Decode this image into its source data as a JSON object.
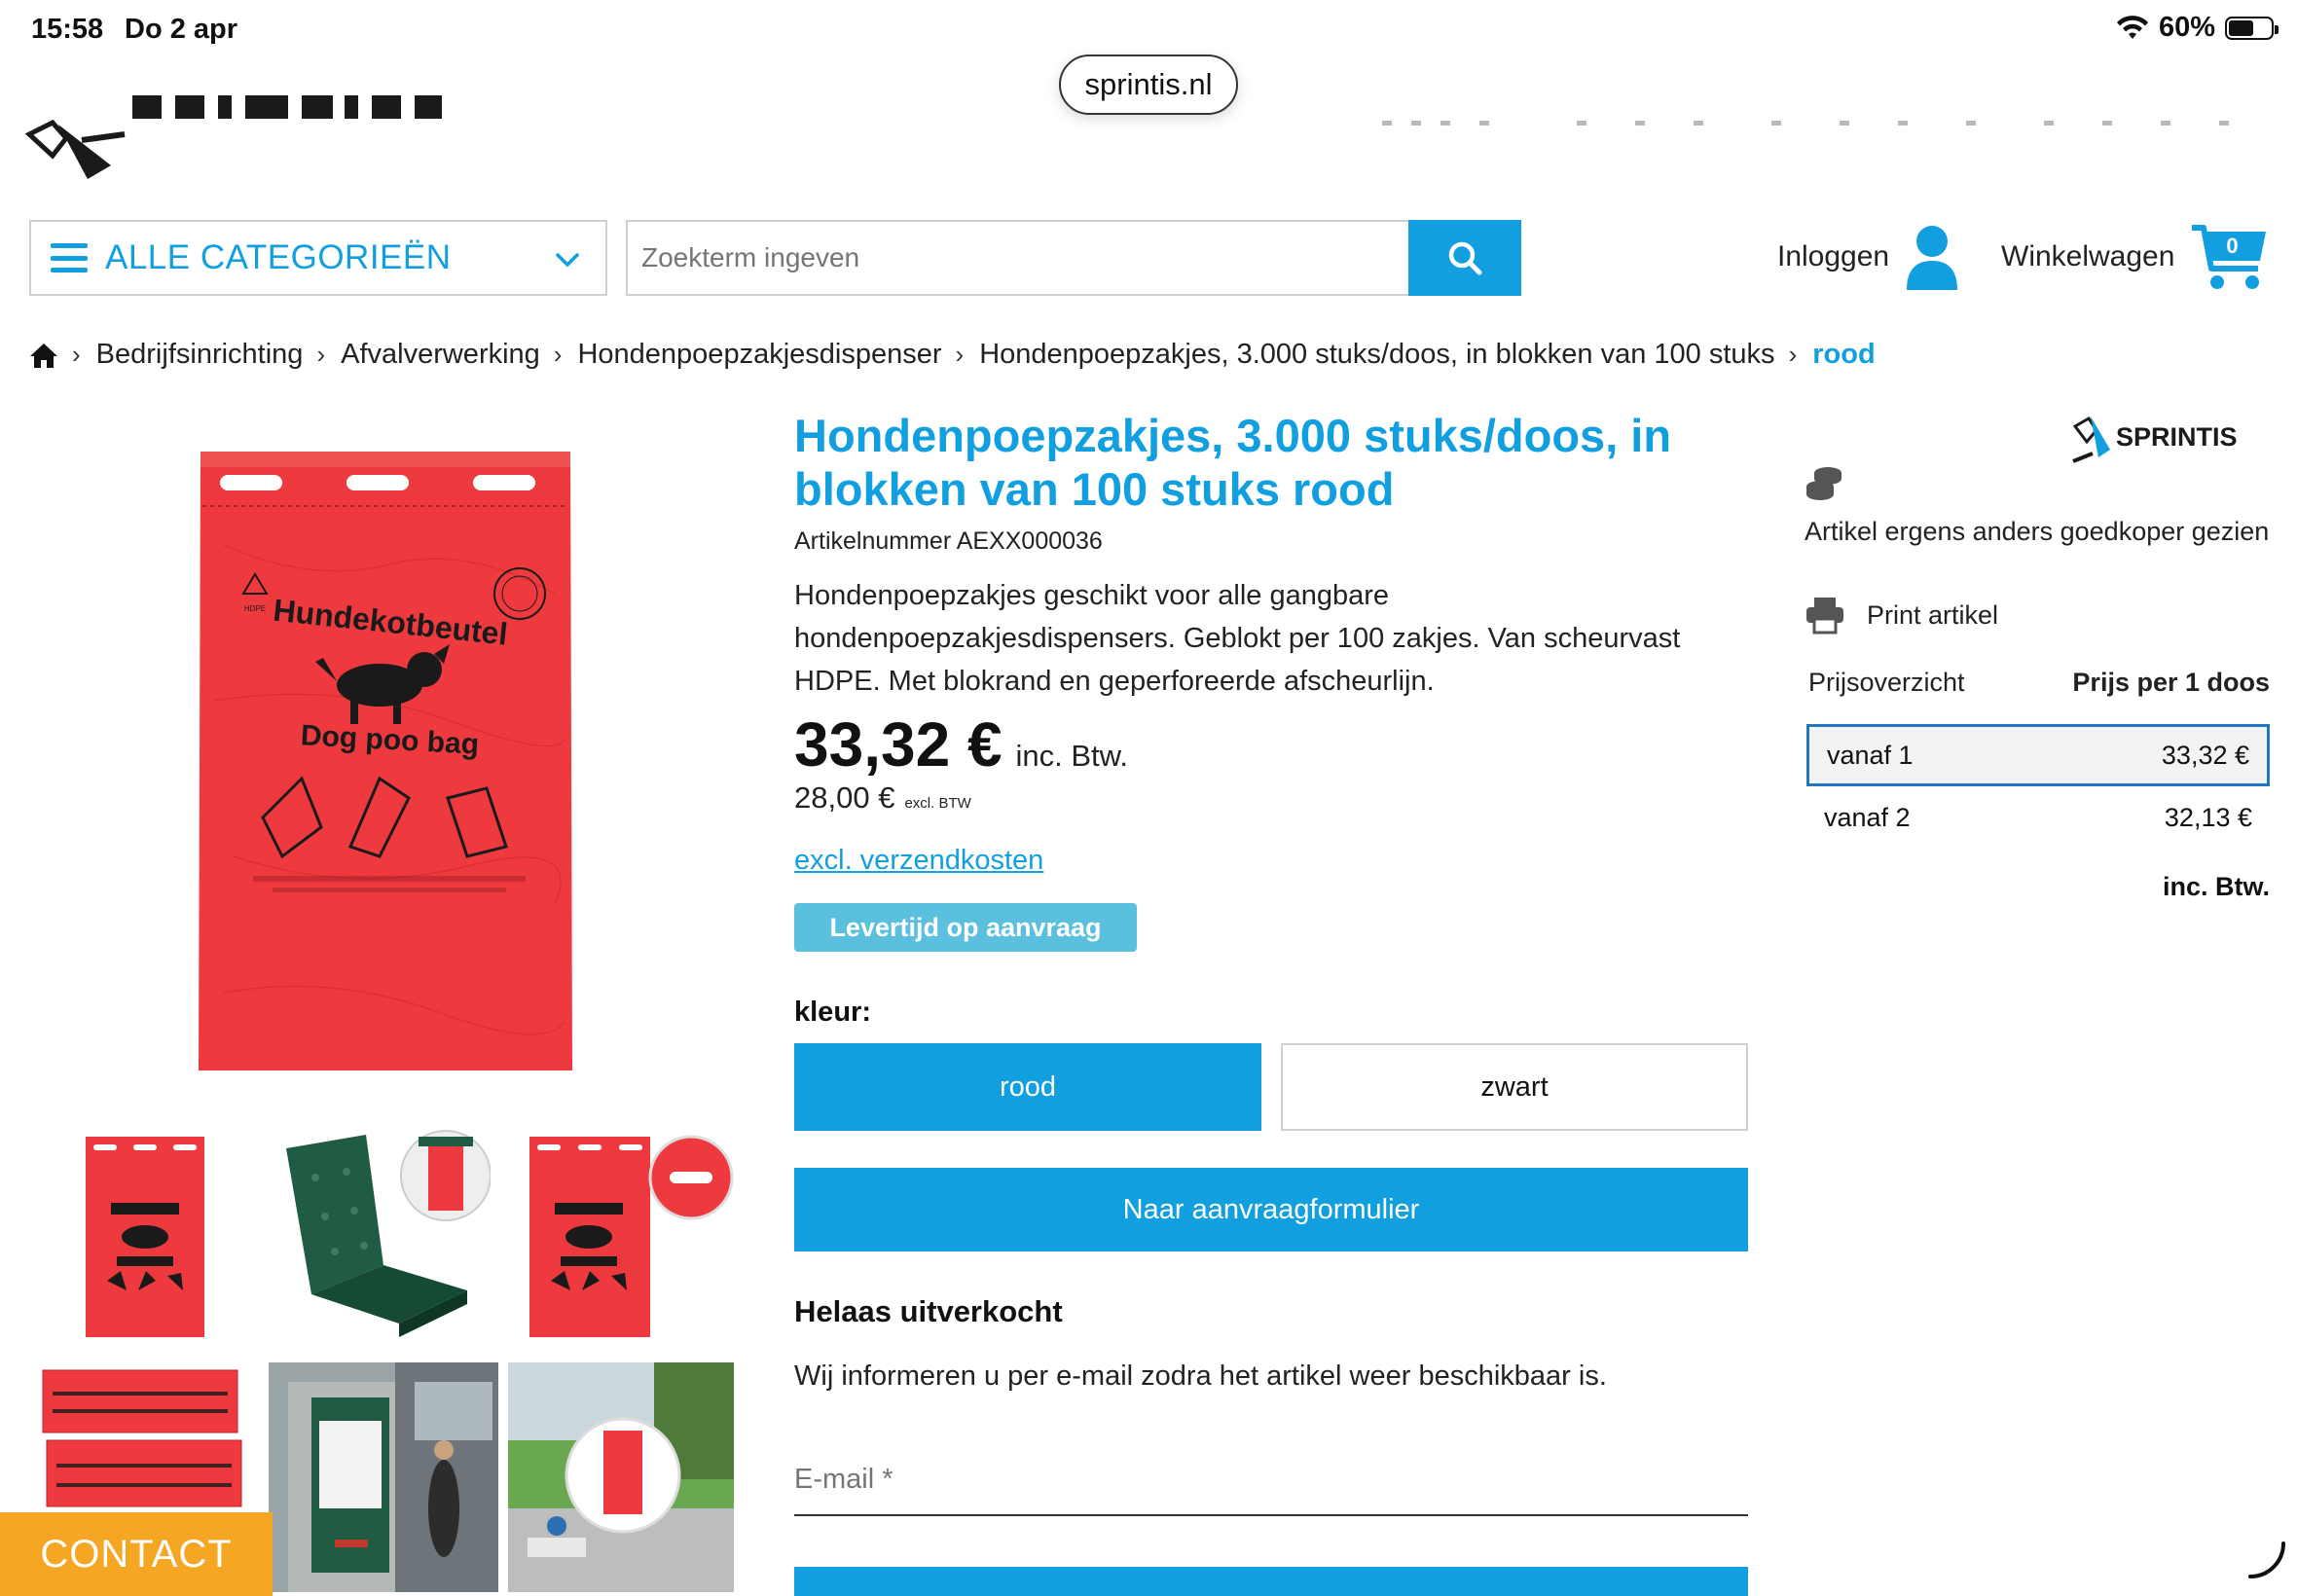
{
  "status_bar": {
    "time": "15:58",
    "date": "Do 2 apr",
    "battery": "60%",
    "battery_level": 0.6,
    "url": "sprintis.nl"
  },
  "header": {
    "categories_label": "ALLE CATEGORIEËN",
    "search_placeholder": "Zoekterm ingeven",
    "login_label": "Inloggen",
    "cart_label": "Winkelwagen",
    "cart_count": "0"
  },
  "breadcrumb": {
    "items": [
      "Bedrijfsinrichting",
      "Afvalverwerking",
      "Hondenpoepzakjesdispenser",
      "Hondenpoepzakjes, 3.000 stuks/doos, in blokken van 100 stuks"
    ],
    "current": "rood"
  },
  "product": {
    "title": "Hondenpoepzakjes, 3.000 stuks/doos, in blokken van 100 stuks rood",
    "sku": "Artikelnummer AEXX000036",
    "description": "Hondenpoepzakjes geschikt voor alle gangbare hondenpoepzakjesdispensers. Geblokt per 100 zakjes. Van scheurvast HDPE. Met blokrand en geperforeerde afscheurlijn.",
    "price_incl": "33,32 €",
    "price_incl_label": "inc. Btw.",
    "price_excl": "28,00 €",
    "price_excl_label": "excl. BTW",
    "shipping_link": "excl. verzendkosten",
    "delivery_badge": "Levertijd op aanvraag",
    "color_label": "kleur:",
    "color_options": [
      "rood",
      "zwart"
    ],
    "cta_label": "Naar aanvraagformulier",
    "soldout_title": "Helaas uitverkocht",
    "soldout_text": "Wij informeren u per e-mail zodra het artikel weer beschikbaar is.",
    "email_placeholder": "E-mail *"
  },
  "bag_print": {
    "brand": "Hundekotbeutel",
    "subtitle": "Dog poo bag"
  },
  "sidebar": {
    "brand": "SPRINTIS",
    "cheaper_text": "Artikel ergens anders goedkoper gezien",
    "print_label": "Print artikel",
    "table_header_left": "Prijsoverzicht",
    "table_header_right": "Prijs per 1 doos",
    "tiers": [
      {
        "label": "vanaf 1",
        "price": "33,32 €"
      },
      {
        "label": "vanaf 2",
        "price": "32,13 €"
      }
    ],
    "footer": "inc. Btw."
  },
  "contact_label": "CONTACT",
  "colors": {
    "accent": "#129fdf",
    "badge": "#5bc0de",
    "contact": "#f5a623",
    "bag_red": "#ee3a3e",
    "dispenser_green": "#1f5c43"
  },
  "icons": [
    "wifi-icon",
    "battery-icon",
    "menu-icon",
    "chevron-down-icon",
    "search-icon",
    "user-icon",
    "cart-icon",
    "home-icon",
    "coins-icon",
    "printer-icon"
  ]
}
